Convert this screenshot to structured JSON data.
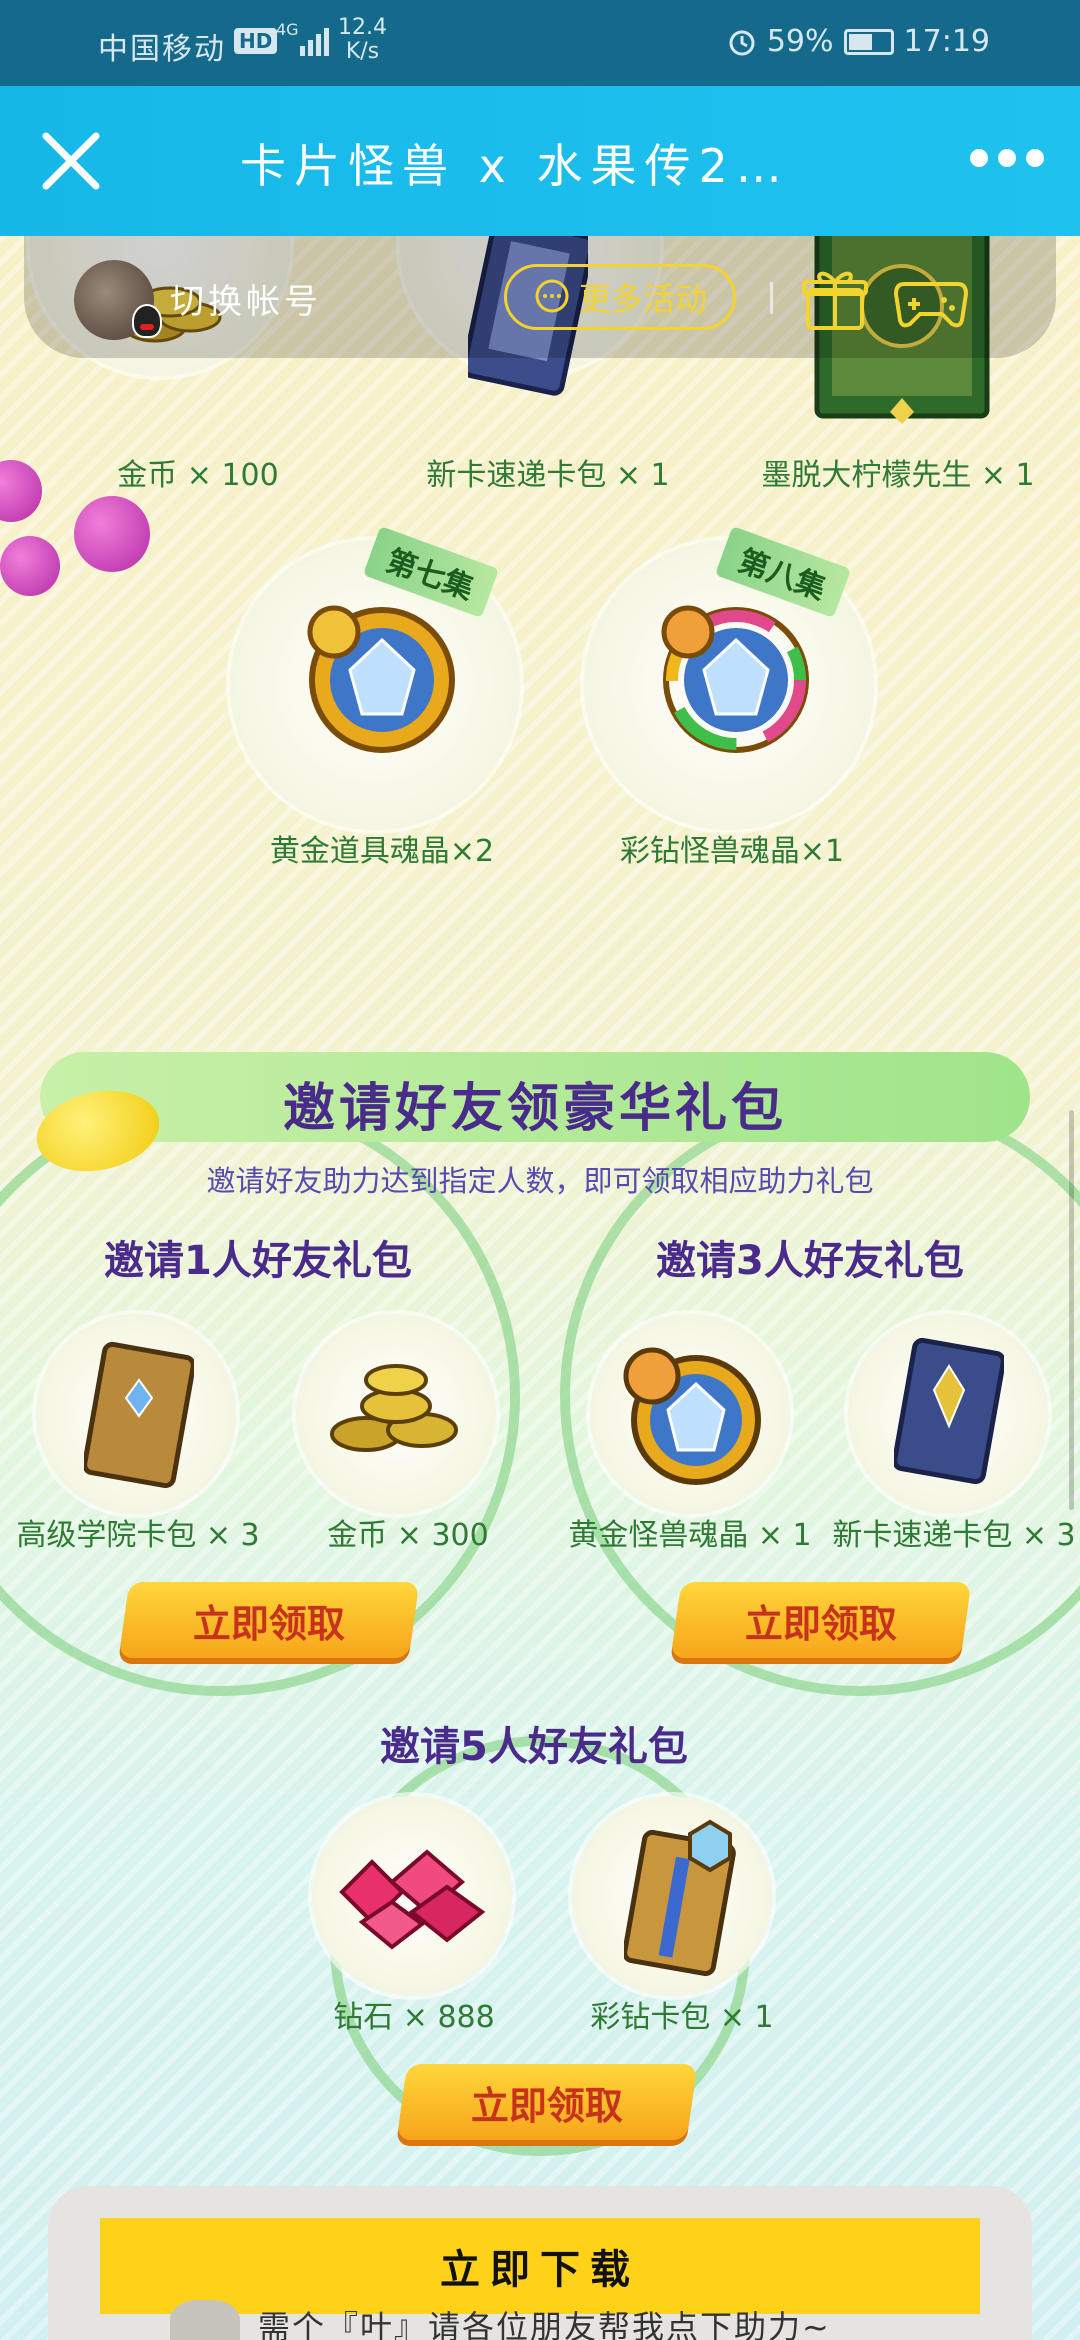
{
  "status_bar": {
    "carrier": "中国移动",
    "hd": "HD",
    "signal": "4G",
    "speed_value": "12.4",
    "speed_unit": "K/s",
    "battery": "59%",
    "battery_level": 0.59,
    "time": "17:19"
  },
  "title_bar": {
    "title": "卡片怪兽 x 水果传2…",
    "close_icon": "close-icon",
    "more_icon": "more-icon"
  },
  "account": {
    "switch_label": "切换帐号",
    "more_activity": "更多活动"
  },
  "rewards_top": [
    {
      "label": "金币 × 100"
    },
    {
      "label": "新卡速递卡包 × 1"
    },
    {
      "label": "墨脱大柠檬先生 × 1"
    }
  ],
  "rewards_episode": [
    {
      "tag": "第七集",
      "label": "黄金道具魂晶×2"
    },
    {
      "tag": "第八集",
      "label": "彩钻怪兽魂晶×1"
    }
  ],
  "invite_section": {
    "title": "邀请好友领豪华礼包",
    "subtitle": "邀请好友助力达到指定人数，即可领取相应助力礼包",
    "packs": [
      {
        "title": "邀请1人好友礼包",
        "items": [
          {
            "label": "高级学院卡包 × 3"
          },
          {
            "label": "金币 × 300"
          }
        ],
        "button": "立即领取"
      },
      {
        "title": "邀请3人好友礼包",
        "items": [
          {
            "label": "黄金怪兽魂晶 × 1"
          },
          {
            "label": "新卡速递卡包 × 3"
          }
        ],
        "button": "立即领取"
      },
      {
        "title": "邀请5人好友礼包",
        "items": [
          {
            "label": "钻石 × 888"
          },
          {
            "label": "彩钻卡包 × 1"
          }
        ],
        "button": "立即领取"
      }
    ]
  },
  "download": {
    "button": "立即下载",
    "message": "需个『叶』请各位朋友帮我点下助力~"
  }
}
